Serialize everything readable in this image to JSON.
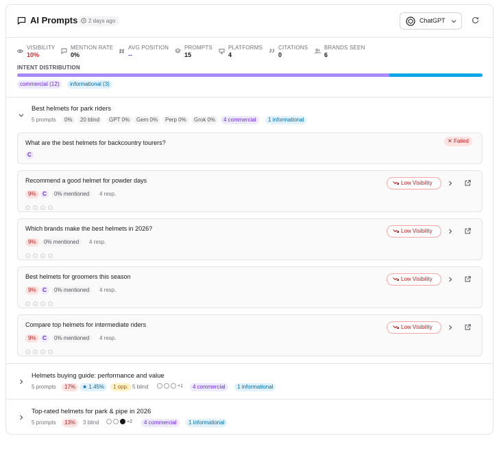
{
  "header": {
    "title": "AI Prompts",
    "time_ago": "2 days ago",
    "model": "ChatGPT"
  },
  "metrics": [
    {
      "label": "VISIBILITY",
      "value": "10%",
      "color": "#dc2626",
      "icon": "eye-icon"
    },
    {
      "label": "MENTION RATE",
      "value": "0%",
      "color": "#18181b",
      "icon": "message-icon"
    },
    {
      "label": "AVG POSITION",
      "value": "--",
      "color": "#4f46e5",
      "icon": "hash-icon"
    },
    {
      "label": "PROMPTS",
      "value": "15",
      "color": "#18181b",
      "icon": "layers-icon"
    },
    {
      "label": "PLATFORMS",
      "value": "4",
      "color": "#18181b",
      "icon": "monitor-icon"
    },
    {
      "label": "CITATIONS",
      "value": "0",
      "color": "#18181b",
      "icon": "quote-icon"
    },
    {
      "label": "BRANDS SEEN",
      "value": "6",
      "color": "#18181b",
      "icon": "users-icon"
    }
  ],
  "intent": {
    "title": "INTENT DISTRIBUTION",
    "commercial": 12,
    "informational": 3,
    "commercial_label": "commercial (12)",
    "informational_label": "informational (3)",
    "colors": {
      "commercial": "#a78bfa",
      "informational": "#0ea5e9"
    }
  },
  "groups": [
    {
      "title": "Best helmets for park riders",
      "expanded": true,
      "meta": {
        "count": "5 prompts",
        "visibility": "0%",
        "blind": "20 blind",
        "gpt": "GPT 0%",
        "gem": "Gem 0%",
        "perp": "Perp 0%",
        "grok": "Grok 0%",
        "commercial": "4 commercial",
        "informational": "1 informational"
      },
      "prompts": [
        {
          "question": "What are the best helmets for backcountry tourers?",
          "status": "Failed",
          "c_tag": "C"
        },
        {
          "question": "Recommend a good helmet for powder days",
          "status": "Low Visibility",
          "visibility": "9%",
          "c_tag": "C",
          "mentioned": "0% mentioned",
          "responses": "4 resp."
        },
        {
          "question": "Which brands make the best helmets in 2026?",
          "status": "Low Visibility",
          "visibility": "9%",
          "mentioned": "0% mentioned",
          "responses": "4 resp."
        },
        {
          "question": "Best helmets for groomers this season",
          "status": "Low Visibility",
          "visibility": "9%",
          "c_tag": "C",
          "mentioned": "0% mentioned",
          "responses": "4 resp."
        },
        {
          "question": "Compare top helmets for intermediate riders",
          "status": "Low Visibility",
          "visibility": "9%",
          "c_tag": "C",
          "mentioned": "0% mentioned",
          "responses": "4 resp."
        }
      ]
    },
    {
      "title": "Helmets buying guide: performance and value",
      "expanded": false,
      "meta": {
        "count": "5 prompts",
        "visibility": "17%",
        "star": "★ 1.45%",
        "opp": "1 opp.",
        "blind": "5 blind",
        "more": "+1",
        "commercial": "4 commercial",
        "informational": "1 informational"
      }
    },
    {
      "title": "Top-rated helmets for park & pipe in 2026",
      "expanded": false,
      "meta": {
        "count": "5 prompts",
        "visibility": "13%",
        "blind": "3 blind",
        "more": "+2",
        "commercial": "4 commercial",
        "informational": "1 informational"
      }
    }
  ]
}
